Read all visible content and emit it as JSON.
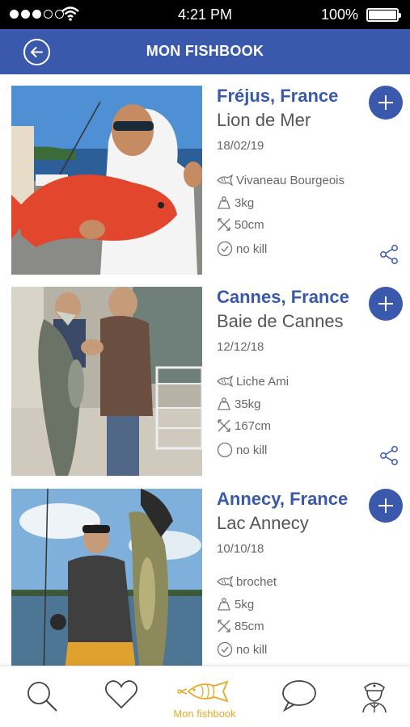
{
  "status_bar": {
    "time": "4:21 PM",
    "battery": "100%",
    "battery_level": 1.0,
    "signal_bars_filled": 3,
    "signal_bars_total": 5
  },
  "header": {
    "title": "MON FISHBOOK",
    "back_icon": "arrow-left-icon"
  },
  "colors": {
    "primary": "#3a59ad",
    "accent": "#e8a92a",
    "text": "#555555"
  },
  "catches": [
    {
      "place": "Fréjus, France",
      "spot": "Lion de Mer",
      "date": "18/02/19",
      "species": "Vivaneau Bourgeois",
      "weight": "3kg",
      "length": "50cm",
      "kill_label": "no kill",
      "no_kill": true
    },
    {
      "place": "Cannes, France",
      "spot": "Baie de Cannes",
      "date": "12/12/18",
      "species": "Liche Ami",
      "weight": "35kg",
      "length": "167cm",
      "kill_label": "no kill",
      "no_kill": false
    },
    {
      "place": "Annecy, France",
      "spot": "Lac Annecy",
      "date": "10/10/18",
      "species": "brochet",
      "weight": "5kg",
      "length": "85cm",
      "kill_label": "no kill",
      "no_kill": true
    }
  ],
  "bottom_nav": {
    "items": [
      {
        "icon": "search-icon",
        "label": ""
      },
      {
        "icon": "heart-icon",
        "label": ""
      },
      {
        "icon": "fish-icon",
        "label": "Mon fishbook",
        "active": true
      },
      {
        "icon": "chat-icon",
        "label": ""
      },
      {
        "icon": "captain-icon",
        "label": ""
      }
    ]
  }
}
